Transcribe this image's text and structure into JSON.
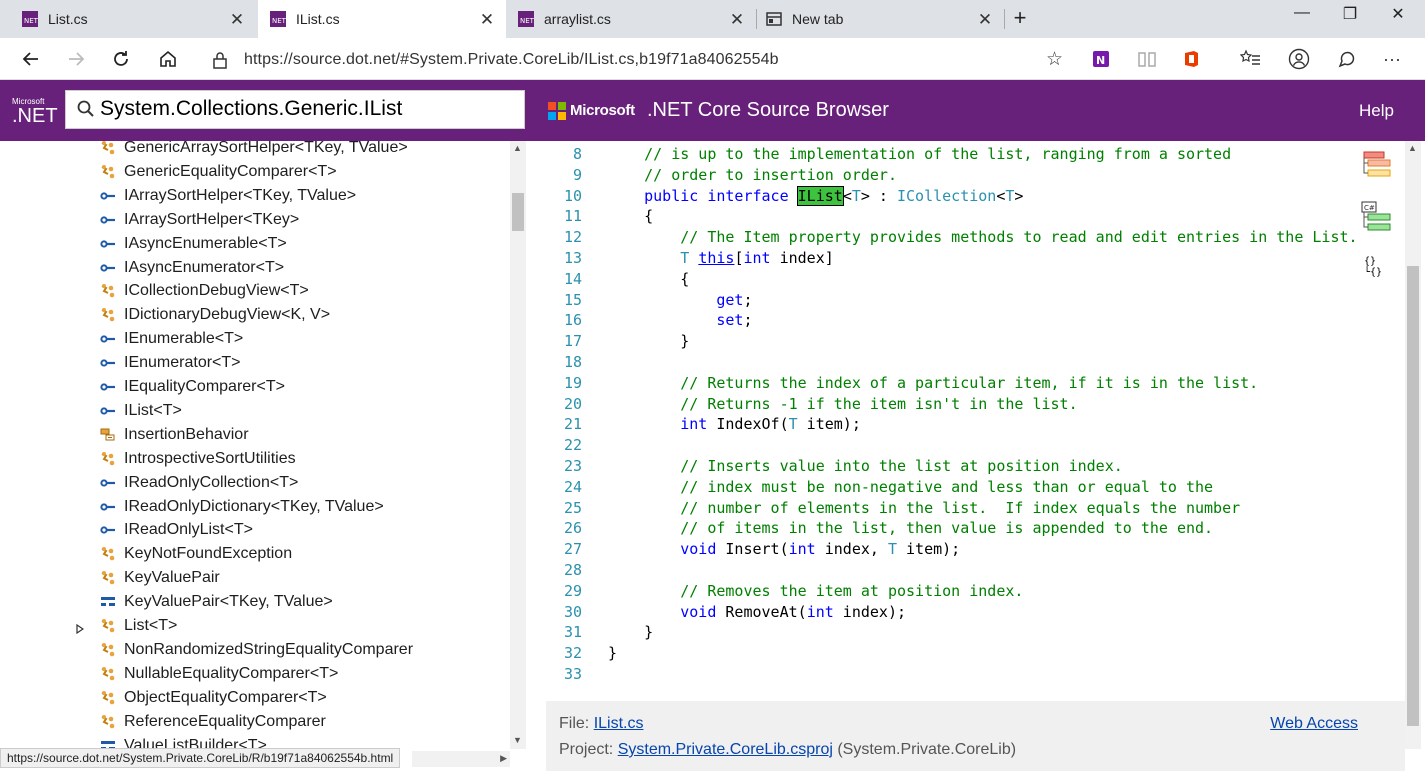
{
  "browser": {
    "tabs": [
      {
        "title": "List.cs",
        "active": false
      },
      {
        "title": "IList.cs",
        "active": true
      },
      {
        "title": "arraylist.cs",
        "active": false
      },
      {
        "title": "New tab",
        "active": false
      }
    ],
    "url": "https://source.dot.net/#System.Private.CoreLib/IList.cs,b19f71a84062554b",
    "status_url": "https://source.dot.net/System.Private.CoreLib/R/b19f71a84062554b.html"
  },
  "header": {
    "logo_small": "Microsoft",
    "logo_big": ".NET",
    "search_value": "System.Collections.Generic.IList",
    "microsoft_label": "Microsoft",
    "title": ".NET Core Source Browser",
    "help": "Help"
  },
  "tree": [
    {
      "label": "GenericArraySortHelper<TKey, TValue>",
      "icon": "class-icon"
    },
    {
      "label": "GenericEqualityComparer<T>",
      "icon": "class-icon"
    },
    {
      "label": "IArraySortHelper<TKey, TValue>",
      "icon": "interface-icon"
    },
    {
      "label": "IArraySortHelper<TKey>",
      "icon": "interface-icon"
    },
    {
      "label": "IAsyncEnumerable<T>",
      "icon": "interface-icon"
    },
    {
      "label": "IAsyncEnumerator<T>",
      "icon": "interface-icon"
    },
    {
      "label": "ICollectionDebugView<T>",
      "icon": "class-icon"
    },
    {
      "label": "IDictionaryDebugView<K, V>",
      "icon": "class-icon"
    },
    {
      "label": "IEnumerable<T>",
      "icon": "interface-icon"
    },
    {
      "label": "IEnumerator<T>",
      "icon": "interface-icon"
    },
    {
      "label": "IEqualityComparer<T>",
      "icon": "interface-icon"
    },
    {
      "label": "IList<T>",
      "icon": "interface-icon"
    },
    {
      "label": "InsertionBehavior",
      "icon": "enum-icon"
    },
    {
      "label": "IntrospectiveSortUtilities",
      "icon": "class-icon"
    },
    {
      "label": "IReadOnlyCollection<T>",
      "icon": "interface-icon"
    },
    {
      "label": "IReadOnlyDictionary<TKey, TValue>",
      "icon": "interface-icon"
    },
    {
      "label": "IReadOnlyList<T>",
      "icon": "interface-icon"
    },
    {
      "label": "KeyNotFoundException",
      "icon": "class-icon"
    },
    {
      "label": "KeyValuePair",
      "icon": "class-icon"
    },
    {
      "label": "KeyValuePair<TKey, TValue>",
      "icon": "struct-icon"
    },
    {
      "label": "List<T>",
      "icon": "class-icon",
      "expandable": true
    },
    {
      "label": "NonRandomizedStringEqualityComparer",
      "icon": "class-icon"
    },
    {
      "label": "NullableEqualityComparer<T>",
      "icon": "class-icon"
    },
    {
      "label": "ObjectEqualityComparer<T>",
      "icon": "class-icon"
    },
    {
      "label": "ReferenceEqualityComparer",
      "icon": "class-icon"
    },
    {
      "label": "ValueListBuilder<T>",
      "icon": "struct-icon"
    }
  ],
  "code": [
    {
      "n": "8",
      "parts": [
        [
          "cm",
          "    // is up to the implementation of the list, ranging from a sorted"
        ]
      ]
    },
    {
      "n": "9",
      "parts": [
        [
          "cm",
          "    // order to insertion order."
        ]
      ]
    },
    {
      "n": "10",
      "parts": [
        [
          "kw",
          "    public interface "
        ],
        [
          "hl",
          "IList"
        ],
        [
          "",
          "<"
        ],
        [
          "ty",
          "T"
        ],
        [
          "",
          "> : "
        ],
        [
          "ty",
          "ICollection"
        ],
        [
          "",
          "<"
        ],
        [
          "ty",
          "T"
        ],
        [
          "",
          ">"
        ]
      ]
    },
    {
      "n": "11",
      "parts": [
        [
          "",
          "    {"
        ]
      ]
    },
    {
      "n": "12",
      "parts": [
        [
          "cm",
          "        // The Item property provides methods to read and edit entries in the List."
        ]
      ]
    },
    {
      "n": "13",
      "parts": [
        [
          "ty",
          "        T "
        ],
        [
          "kwlk",
          "this"
        ],
        [
          "",
          "["
        ],
        [
          "kw",
          "int"
        ],
        [
          "",
          " index]"
        ]
      ]
    },
    {
      "n": "14",
      "parts": [
        [
          "",
          "        {"
        ]
      ]
    },
    {
      "n": "15",
      "parts": [
        [
          "kw",
          "            get"
        ],
        [
          "",
          ";"
        ]
      ]
    },
    {
      "n": "16",
      "parts": [
        [
          "kw",
          "            set"
        ],
        [
          "",
          ";"
        ]
      ]
    },
    {
      "n": "17",
      "parts": [
        [
          "",
          "        }"
        ]
      ]
    },
    {
      "n": "18",
      "parts": [
        [
          "",
          ""
        ]
      ]
    },
    {
      "n": "19",
      "parts": [
        [
          "cm",
          "        // Returns the index of a particular item, if it is in the list."
        ]
      ]
    },
    {
      "n": "20",
      "parts": [
        [
          "cm",
          "        // Returns -1 if the item isn't in the list."
        ]
      ]
    },
    {
      "n": "21",
      "parts": [
        [
          "kw",
          "        int"
        ],
        [
          "",
          " IndexOf("
        ],
        [
          "ty",
          "T"
        ],
        [
          "",
          " item);"
        ]
      ]
    },
    {
      "n": "22",
      "parts": [
        [
          "",
          ""
        ]
      ]
    },
    {
      "n": "23",
      "parts": [
        [
          "cm",
          "        // Inserts value into the list at position index."
        ]
      ]
    },
    {
      "n": "24",
      "parts": [
        [
          "cm",
          "        // index must be non-negative and less than or equal to the"
        ]
      ]
    },
    {
      "n": "25",
      "parts": [
        [
          "cm",
          "        // number of elements in the list.  If index equals the number"
        ]
      ]
    },
    {
      "n": "26",
      "parts": [
        [
          "cm",
          "        // of items in the list, then value is appended to the end."
        ]
      ]
    },
    {
      "n": "27",
      "parts": [
        [
          "kw",
          "        void"
        ],
        [
          "",
          " Insert("
        ],
        [
          "kw",
          "int"
        ],
        [
          "",
          " index, "
        ],
        [
          "ty",
          "T"
        ],
        [
          "",
          " item);"
        ]
      ]
    },
    {
      "n": "28",
      "parts": [
        [
          "",
          ""
        ]
      ]
    },
    {
      "n": "29",
      "parts": [
        [
          "cm",
          "        // Removes the item at position index."
        ]
      ]
    },
    {
      "n": "30",
      "parts": [
        [
          "kw",
          "        void"
        ],
        [
          "",
          " RemoveAt("
        ],
        [
          "kw",
          "int"
        ],
        [
          "",
          " index);"
        ]
      ]
    },
    {
      "n": "31",
      "parts": [
        [
          "",
          "    }"
        ]
      ]
    },
    {
      "n": "32",
      "parts": [
        [
          "",
          "}"
        ]
      ]
    },
    {
      "n": "33",
      "parts": [
        [
          "",
          ""
        ]
      ]
    }
  ],
  "footer": {
    "file_label": "File:",
    "file_name": "IList.cs",
    "project_label": "Project:",
    "project_name": "System.Private.CoreLib.csproj",
    "project_suffix": "(System.Private.CoreLib)",
    "web_access": "Web Access"
  },
  "colors": {
    "header_purple": "#68217a",
    "keyword": "#0000ff",
    "comment": "#008000",
    "type": "#2b91af",
    "highlight": "#3ec33e"
  }
}
